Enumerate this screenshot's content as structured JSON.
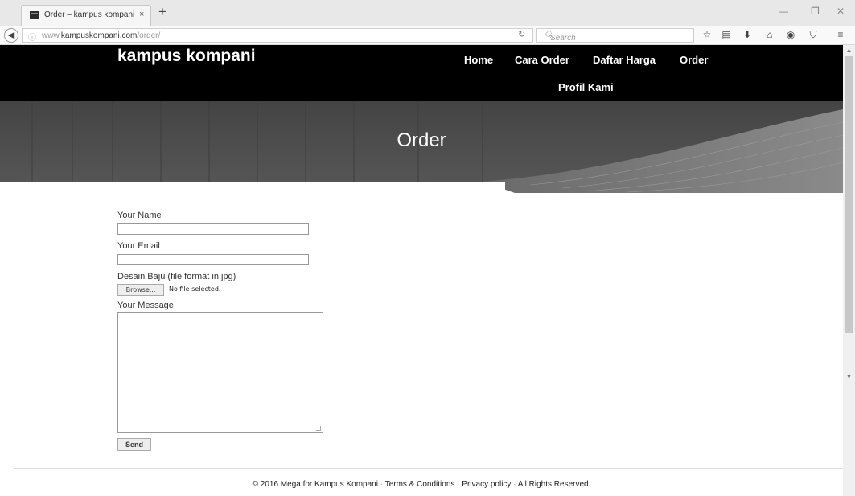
{
  "browser": {
    "tab_title": "Order – kampus kompani",
    "tab_close": "×",
    "new_tab": "+",
    "url_prefix": "www.",
    "url_domain": "kampuskompani.com",
    "url_path": "/order/",
    "search_placeholder": "Search",
    "icons": [
      "back-icon",
      "info-icon",
      "reload-icon",
      "search-icon",
      "bookmark-star-icon",
      "reader-icon",
      "download-icon",
      "home-icon",
      "sync-icon",
      "pocket-icon",
      "menu-icon"
    ]
  },
  "site": {
    "logo": "kampus kompani",
    "nav": {
      "home": "Home",
      "cara_order": "Cara Order",
      "daftar_harga": "Daftar Harga",
      "order": "Order",
      "profil_kami": "Profil Kami"
    },
    "banner_title": "Order"
  },
  "form": {
    "name_label": "Your Name",
    "email_label": "Your Email",
    "design_label": "Desain Baju (file format in jpg)",
    "browse_label": "Browse...",
    "file_status": "No file selected.",
    "message_label": "Your Message",
    "send_label": "Send"
  },
  "footer": {
    "copyright": "© 2016 Mega for Kampus Kompani",
    "terms": "Terms & Conditions",
    "privacy": "Privacy policy",
    "rights": "All Rights Reserved."
  },
  "colors": {
    "header_bg": "#000000",
    "banner_bg": "#4a4a4a"
  }
}
